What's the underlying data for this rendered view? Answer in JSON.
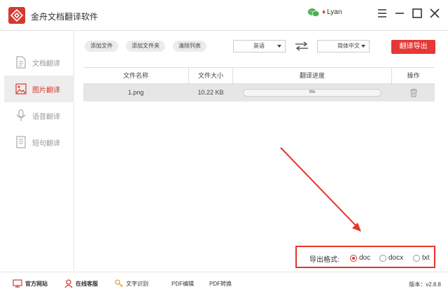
{
  "app": {
    "title": "金舟文档翻译软件",
    "user": "Lyan",
    "brand_color": "#d6382f"
  },
  "sidebar": {
    "items": [
      {
        "label": "文档翻译",
        "icon": "document-icon",
        "active": false
      },
      {
        "label": "图片翻译",
        "icon": "image-icon",
        "active": true
      },
      {
        "label": "语音翻译",
        "icon": "microphone-icon",
        "active": false
      },
      {
        "label": "短句翻译",
        "icon": "text-icon",
        "active": false
      }
    ]
  },
  "toolbar": {
    "add_file": "添加文件",
    "add_folder": "添加文件夹",
    "clear_list": "清除列表",
    "source_lang": "英语",
    "target_lang": "简体中文",
    "export": "翻译导出"
  },
  "table": {
    "headers": [
      "文件名称",
      "文件大小",
      "翻译进度",
      "操作"
    ],
    "rows": [
      {
        "name": "1.png",
        "size": "10.22 KB",
        "progress": 0,
        "progress_text": "0%"
      }
    ]
  },
  "export_format": {
    "label": "导出格式:",
    "options": [
      "doc",
      "docx",
      "txt"
    ],
    "selected": "doc"
  },
  "footer": {
    "items": [
      "官方网站",
      "在线客服",
      "文字识别",
      "PDF编辑",
      "PDF转换"
    ],
    "version": "版本：v2.8.8"
  }
}
